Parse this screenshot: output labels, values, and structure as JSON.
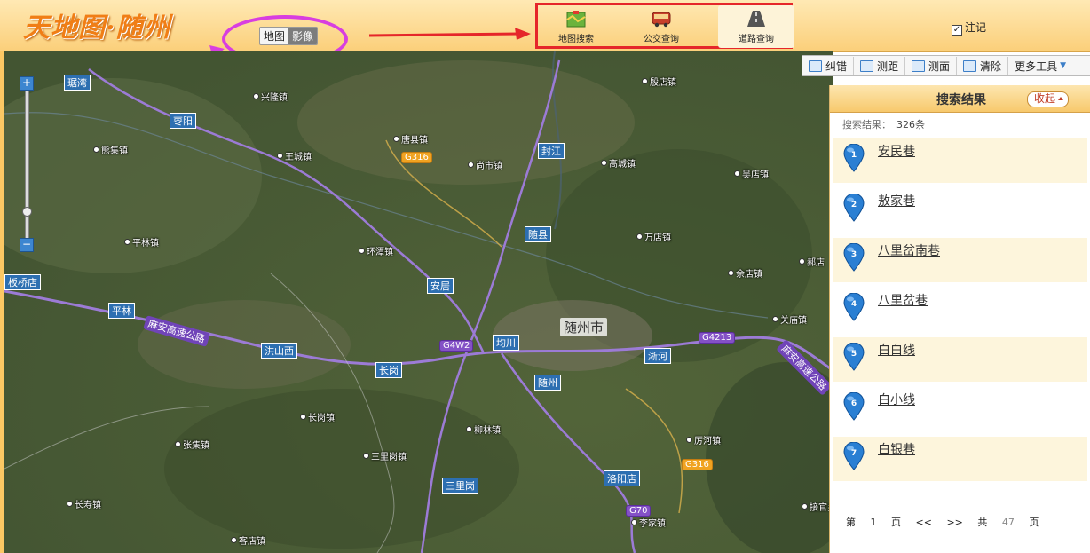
{
  "header": {
    "logo_text": "天地图·随州",
    "map_types": [
      "地图",
      "影像"
    ],
    "annotation_label": "注记",
    "tools": [
      {
        "label": "地图搜索",
        "icon": "map-search-icon"
      },
      {
        "label": "公交查询",
        "icon": "bus-icon"
      },
      {
        "label": "道路查询",
        "icon": "road-icon"
      }
    ]
  },
  "map_tools": [
    {
      "label": "纠错",
      "icon": "correction-icon"
    },
    {
      "label": "测距",
      "icon": "ruler-icon"
    },
    {
      "label": "测面",
      "icon": "area-icon"
    },
    {
      "label": "清除",
      "icon": "clear-icon"
    },
    {
      "label": "更多工具",
      "icon": "chevron-down-icon"
    }
  ],
  "zoom": {
    "plus": "+",
    "minus": "−"
  },
  "map": {
    "city": "随州市",
    "highlighted_places": [
      "琚湾",
      "枣阳",
      "封江",
      "随县",
      "安居",
      "平林",
      "洪山西",
      "长岗",
      "均川",
      "淅河",
      "随州",
      "三里岗",
      "洛阳店",
      "板桥店"
    ],
    "towns": [
      "兴隆镇",
      "殷店镇",
      "熊集镇",
      "唐县镇",
      "王城镇",
      "尚市镇",
      "高城镇",
      "吴店镇",
      "平林镇",
      "环潭镇",
      "万店镇",
      "郝店",
      "余店镇",
      "关庙镇",
      "长岗镇",
      "柳林镇",
      "厉河镇",
      "张集镇",
      "三里岗镇",
      "长寿镇",
      "李家镇",
      "接官乡",
      "客店镇"
    ],
    "shields": [
      "G316",
      "G4W2",
      "G4213",
      "G316",
      "G70"
    ],
    "expressways": [
      "麻安高速公路",
      "麻安高速公路"
    ]
  },
  "results": {
    "title": "搜索结果",
    "collapse_label": "收起",
    "summary_label": "搜索结果：",
    "count": "326条",
    "items": [
      {
        "num": "1",
        "name": "安民巷"
      },
      {
        "num": "2",
        "name": "敖家巷"
      },
      {
        "num": "3",
        "name": "八里岔南巷"
      },
      {
        "num": "4",
        "name": "八里岔巷"
      },
      {
        "num": "5",
        "name": "白白线"
      },
      {
        "num": "6",
        "name": "白小线"
      },
      {
        "num": "7",
        "name": "白银巷"
      }
    ],
    "pager": {
      "prefix": "第",
      "page": "1",
      "page_unit": "页",
      "prev": "<<",
      "next": ">>",
      "total_label": "共",
      "total": "47",
      "total_unit": "页"
    }
  },
  "colors": {
    "header_accent": "#f07e16",
    "annotation_red": "#e5262a",
    "annotation_magenta": "#d83ee0",
    "pin_blue": "#2a7fd3"
  }
}
